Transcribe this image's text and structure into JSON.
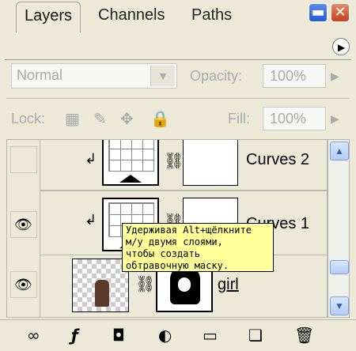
{
  "window": {
    "minimize_glyph": "▬",
    "close_glyph": "✕"
  },
  "tabs": [
    {
      "label": "Layers"
    },
    {
      "label": "Channels"
    },
    {
      "label": "Paths"
    }
  ],
  "panel_menu_glyph": "▶",
  "blend_mode": {
    "value": "Normal"
  },
  "opacity": {
    "label": "Opacity:",
    "value": "100%"
  },
  "lock": {
    "label": "Lock:"
  },
  "fill": {
    "label": "Fill:",
    "value": "100%"
  },
  "layers": [
    {
      "name": "Curves 2",
      "visible": false,
      "type": "adjustment",
      "clipped": true
    },
    {
      "name": "Curves 1",
      "visible": true,
      "type": "adjustment",
      "clipped": true
    },
    {
      "name": "girl",
      "visible": true,
      "type": "image"
    }
  ],
  "tooltip": {
    "text": "Удерживая Alt+щёлкните\nм/у двумя слоями,\nчтобы создать\nобтравочную маску."
  },
  "icons": {
    "eye": "👁",
    "chain": "⛓",
    "clip_arrow": "↲",
    "move": "✥",
    "lock": "🔒",
    "brush": "✎",
    "checker": "▦",
    "link_layers": "∞",
    "fx": "ƒ",
    "mask": "◘",
    "adjustment": "◐",
    "folder": "▭",
    "new_layer": "❏",
    "trash": "🗑"
  }
}
